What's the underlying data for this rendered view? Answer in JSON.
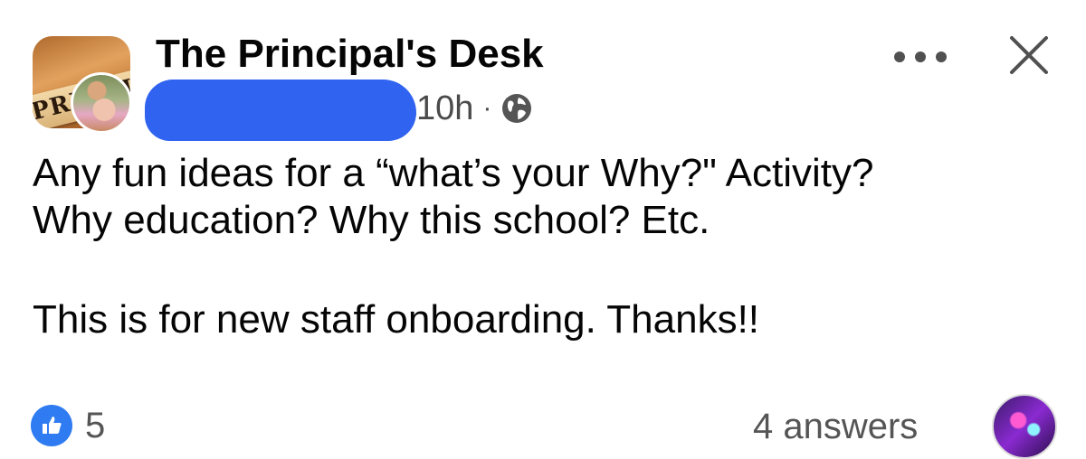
{
  "post": {
    "group_name": "The Principal's Desk",
    "group_avatar_text": "PRINCIP",
    "timestamp": "10h",
    "separator": "·",
    "audience_icon": "globe-icon",
    "body_line1": "Any fun ideas for a “what’s your Why?\" Activity?",
    "body_line2": "Why education? Why this school? Etc.",
    "body_line3": "This is for new staff onboarding. Thanks!!"
  },
  "header": {
    "more_icon": "more-options-icon",
    "close_icon": "close-icon"
  },
  "footer": {
    "like_icon": "thumbs-up-icon",
    "reaction_count": "5",
    "answers_label": "4 answers"
  },
  "colors": {
    "like_blue": "#2f7bf2",
    "redaction_blue": "#2f63f0",
    "text": "#050505",
    "secondary_text": "#555555"
  }
}
